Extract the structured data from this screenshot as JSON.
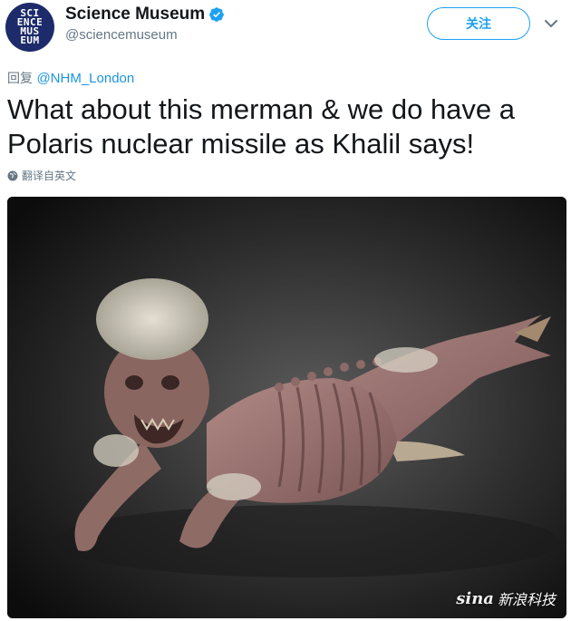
{
  "header": {
    "avatar_lines": [
      "SCI",
      "ENCE",
      "MUS",
      "EUM"
    ],
    "display_name": "Science Museum",
    "handle": "@sciencemuseum",
    "follow_label": "关注",
    "verified_icon": "verified-badge-icon",
    "menu_icon": "chevron-down-icon"
  },
  "tweet": {
    "reply_prefix": "回复",
    "reply_mention": "@NHM_London",
    "text": "What about this merman & we do have a Polaris nuclear missile as Khalil says!",
    "translate_label": "翻译自英文",
    "translate_icon": "globe-icon"
  },
  "media": {
    "watermark_brand": "sina",
    "watermark_text": "新浪科技"
  },
  "colors": {
    "accent": "#1da1f2",
    "mention": "#1b95e0",
    "secondary_text": "#657786",
    "avatar_bg": "#1d2b6b"
  }
}
